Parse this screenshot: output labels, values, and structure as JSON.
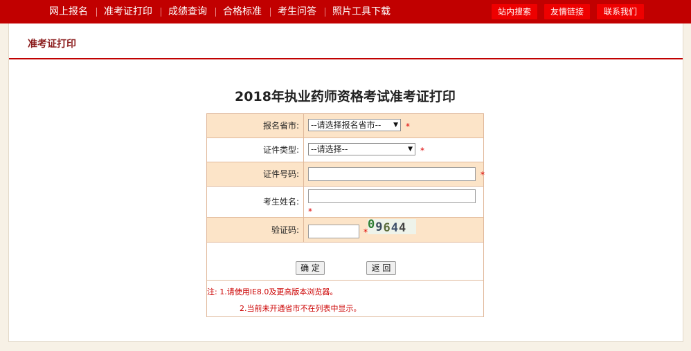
{
  "nav": {
    "items": [
      "网上报名",
      "准考证打印",
      "成绩查询",
      "合格标准",
      "考生问答",
      "照片工具下载"
    ],
    "buttons": [
      "站内搜索",
      "友情链接",
      "联系我们"
    ]
  },
  "panel": {
    "title": "准考证打印"
  },
  "form": {
    "title": "2018年执业药师资格考试准考证打印",
    "province_label": "报名省市:",
    "province_value": "--请选择报名省市--",
    "idtype_label": "证件类型:",
    "idtype_value": "--请选择--",
    "idno_label": "证件号码:",
    "name_label": "考生姓名:",
    "captcha_label": "验证码:",
    "captcha_text": [
      "0",
      "9",
      "6",
      "4",
      "4"
    ],
    "required_mark": "*",
    "confirm_label": "确 定",
    "back_label": "返 回",
    "note1": "注: 1.请使用IE8.0及更高版本浏览器。",
    "note2": "2.当前未开通省市不在列表中显示。"
  },
  "colors": {
    "nav_bg": "#c10000",
    "button_bg": "#ee0000",
    "row_shade": "#fce4c8",
    "required": "#dd0000"
  }
}
